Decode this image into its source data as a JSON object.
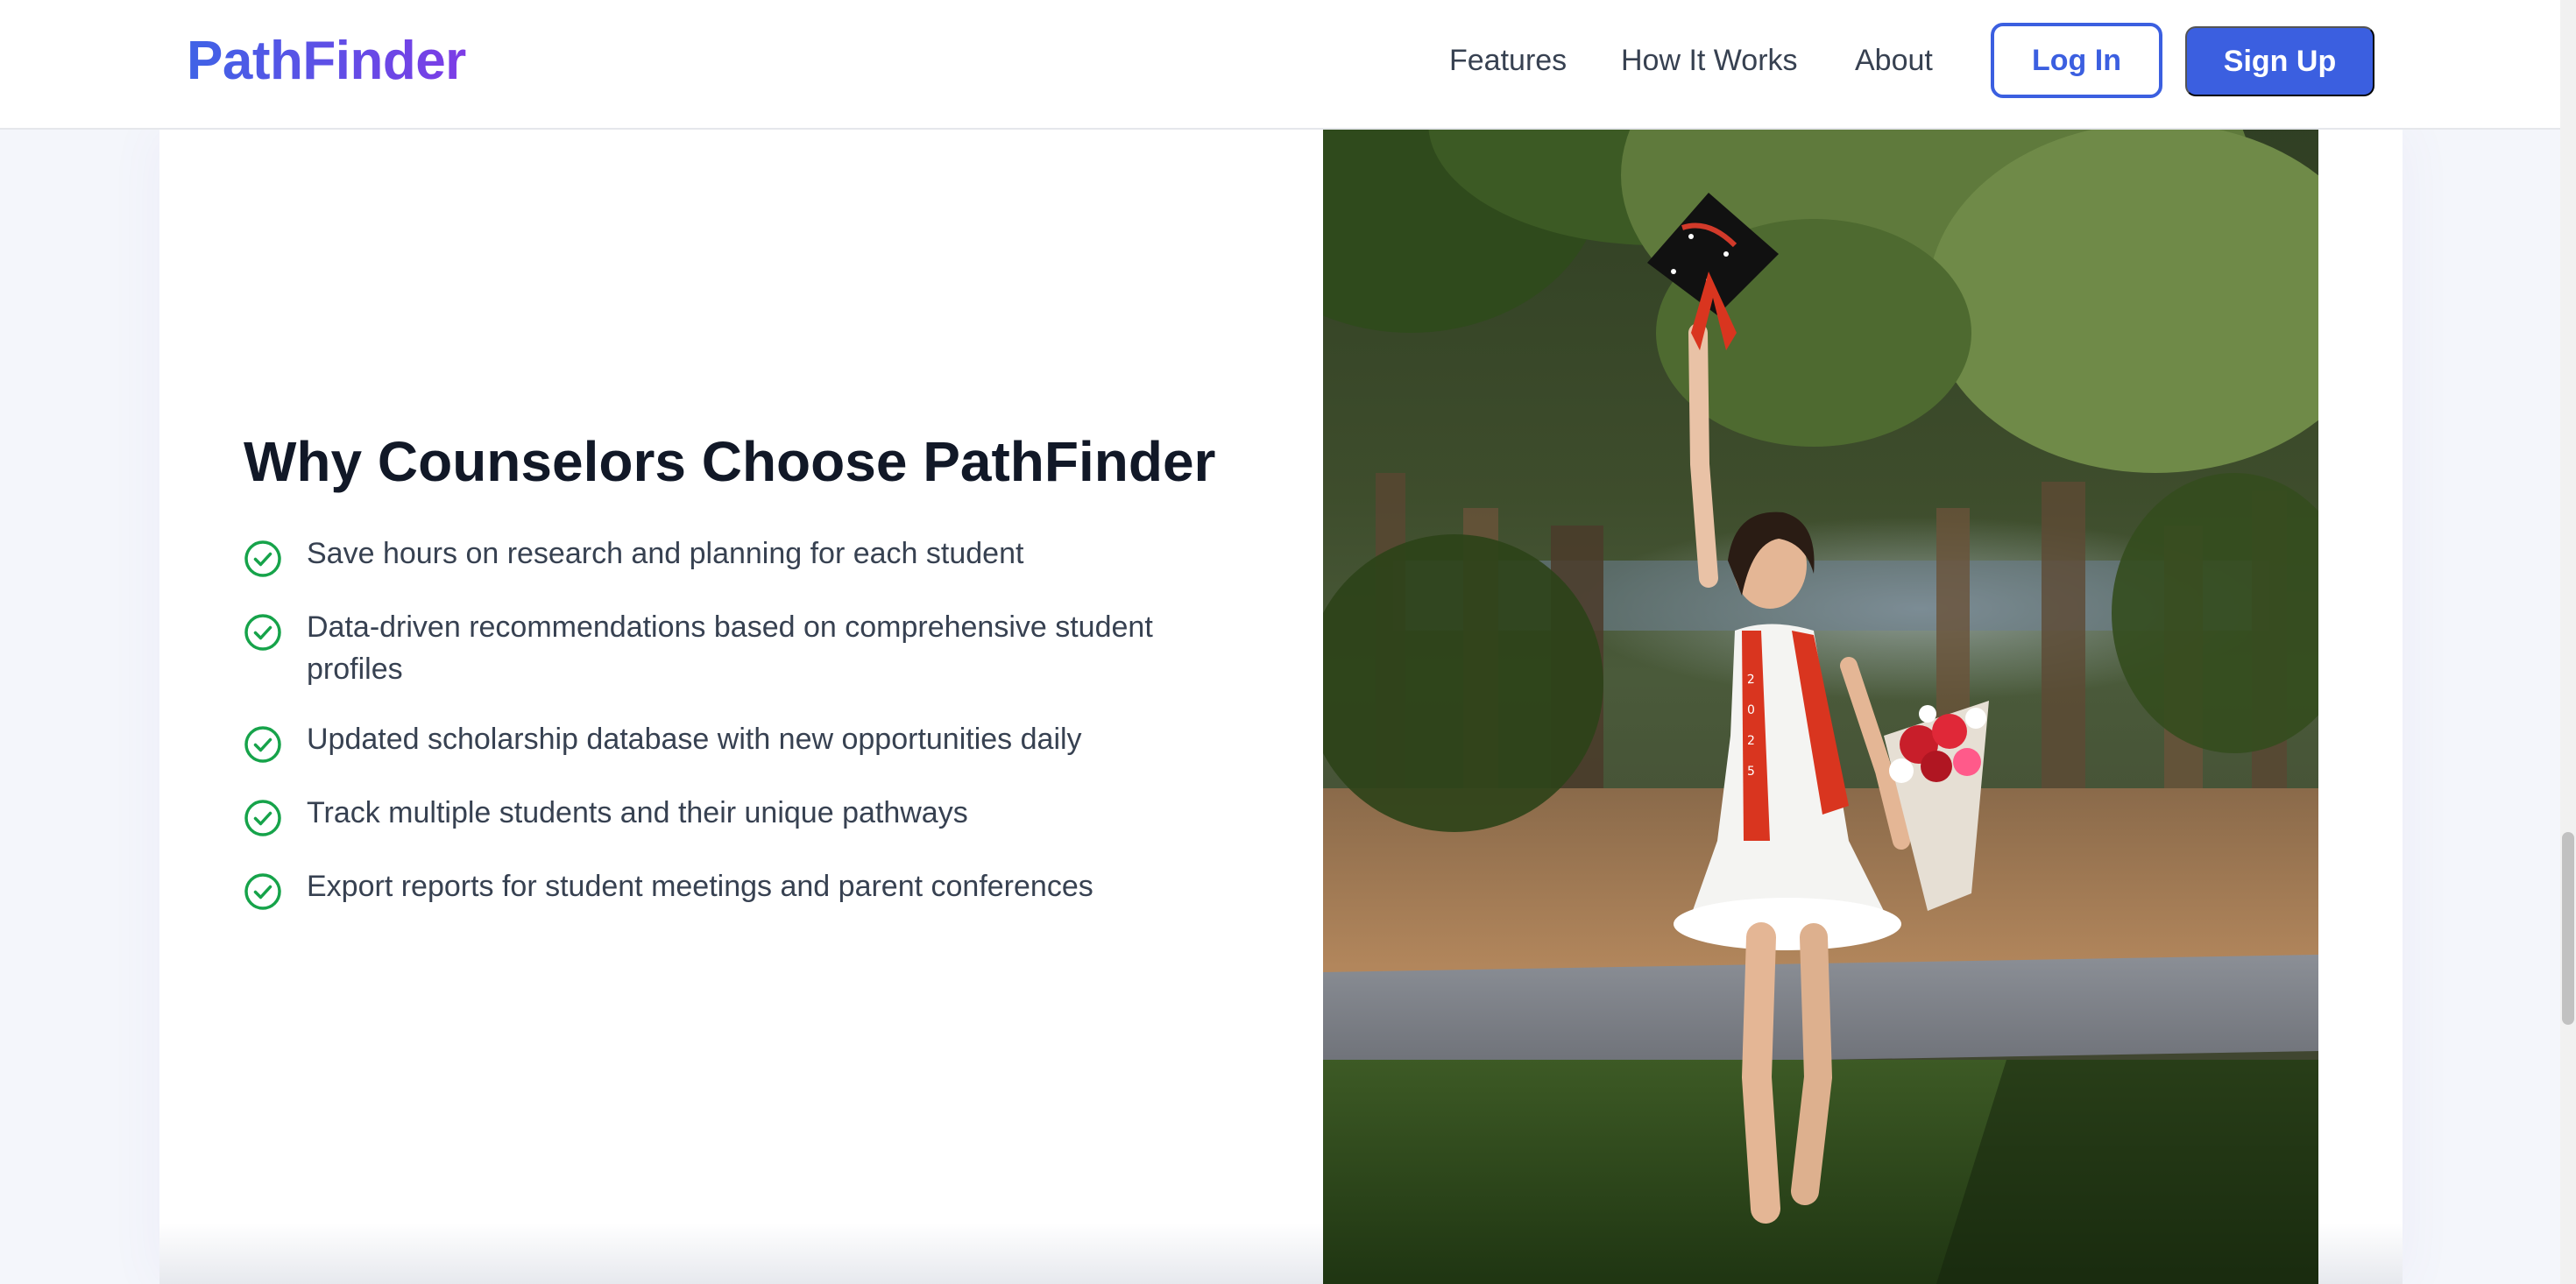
{
  "brand": {
    "name": "PathFinder",
    "gradient_start": "#3f63e6",
    "gradient_end": "#7d3ce6"
  },
  "nav": {
    "links": [
      {
        "label": "Features"
      },
      {
        "label": "How It Works"
      },
      {
        "label": "About"
      }
    ],
    "login_label": "Log In",
    "signup_label": "Sign Up",
    "accent_color": "#3b5fe0"
  },
  "section": {
    "title": "Why Counselors Choose PathFinder",
    "benefits": [
      {
        "text": "Save hours on research and planning for each student"
      },
      {
        "text": "Data-driven recommendations based on comprehensive student profiles"
      },
      {
        "text": "Updated scholarship database with new opportunities daily"
      },
      {
        "text": "Track multiple students and their unique pathways"
      },
      {
        "text": "Export reports for student meetings and parent conferences"
      }
    ],
    "check_icon": "check-circle-icon",
    "check_color": "#16a34a"
  },
  "photo": {
    "subject": "graduate in white dress with red stole holding up graduation cap and bouquet of flowers"
  }
}
